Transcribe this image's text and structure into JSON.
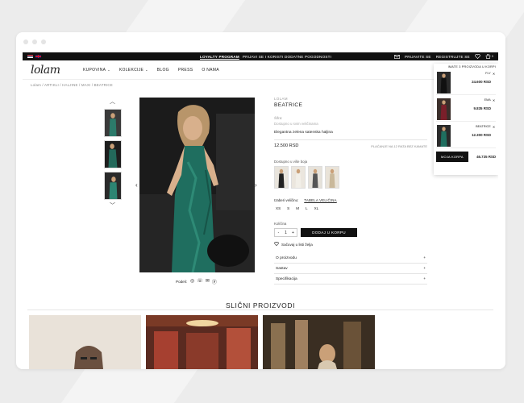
{
  "topbar": {
    "promo_strong": "LOYALTY PROGRAM",
    "promo_text": "PRIJAVI SE I KORISTI DODATNE POGODNOSTI",
    "login": "PRIJAVITE SE",
    "register": "REGISTRUJTE SE",
    "cart_count": "3"
  },
  "nav": {
    "logo": "lolam",
    "items": [
      {
        "label": "KUPOVINA"
      },
      {
        "label": "KOLEKCIJE"
      },
      {
        "label": "BLOG"
      },
      {
        "label": "PRESS"
      },
      {
        "label": "O NAMA"
      }
    ]
  },
  "breadcrumb": "Lolam / ARTIKLI / HALJINE / MAXI / BEATRICE",
  "product": {
    "brand": "LOLAM",
    "name": "BEATRICE",
    "sku_label": "Šifra:",
    "sku_text": "Dostupno u svim veličinama",
    "description": "Elegantna zelena satenska haljina",
    "price": "12.500 RSD",
    "installment": "PLAĆANJE NA 12 RATA BEZ KAMATE",
    "colors_label": "Dostupno u više boja",
    "size_label": "Izaberi veličinu:",
    "size_guide": "TABELA VELIČINA",
    "sizes": [
      "XS",
      "S",
      "M",
      "L",
      "XL"
    ],
    "qty_label": "Količina",
    "qty_value": "1",
    "add_to_cart": "DODAJ U KORPU",
    "wishlist": "Sačuvaj u listi želja",
    "accordion": [
      "O proizvodu",
      "Sastav",
      "Specifikacija"
    ],
    "share_label": "Podeli:"
  },
  "cart": {
    "header": "IMATE 3 PROIZVODA U KORPI",
    "items": [
      {
        "name": "FLY",
        "price": "24.600 RSD"
      },
      {
        "name": "EMA",
        "price": "9.835 RSD"
      },
      {
        "name": "BEATRICE",
        "price": "12.300 RSD"
      }
    ],
    "button": "MOJA KORPA",
    "total": "46.735 RSD"
  },
  "similar": {
    "title": "SLIČNI PROIZVODI"
  },
  "colors": {
    "dark": "#111111",
    "dress_green": "#1f6e5f",
    "border": "#e4e4e4"
  }
}
